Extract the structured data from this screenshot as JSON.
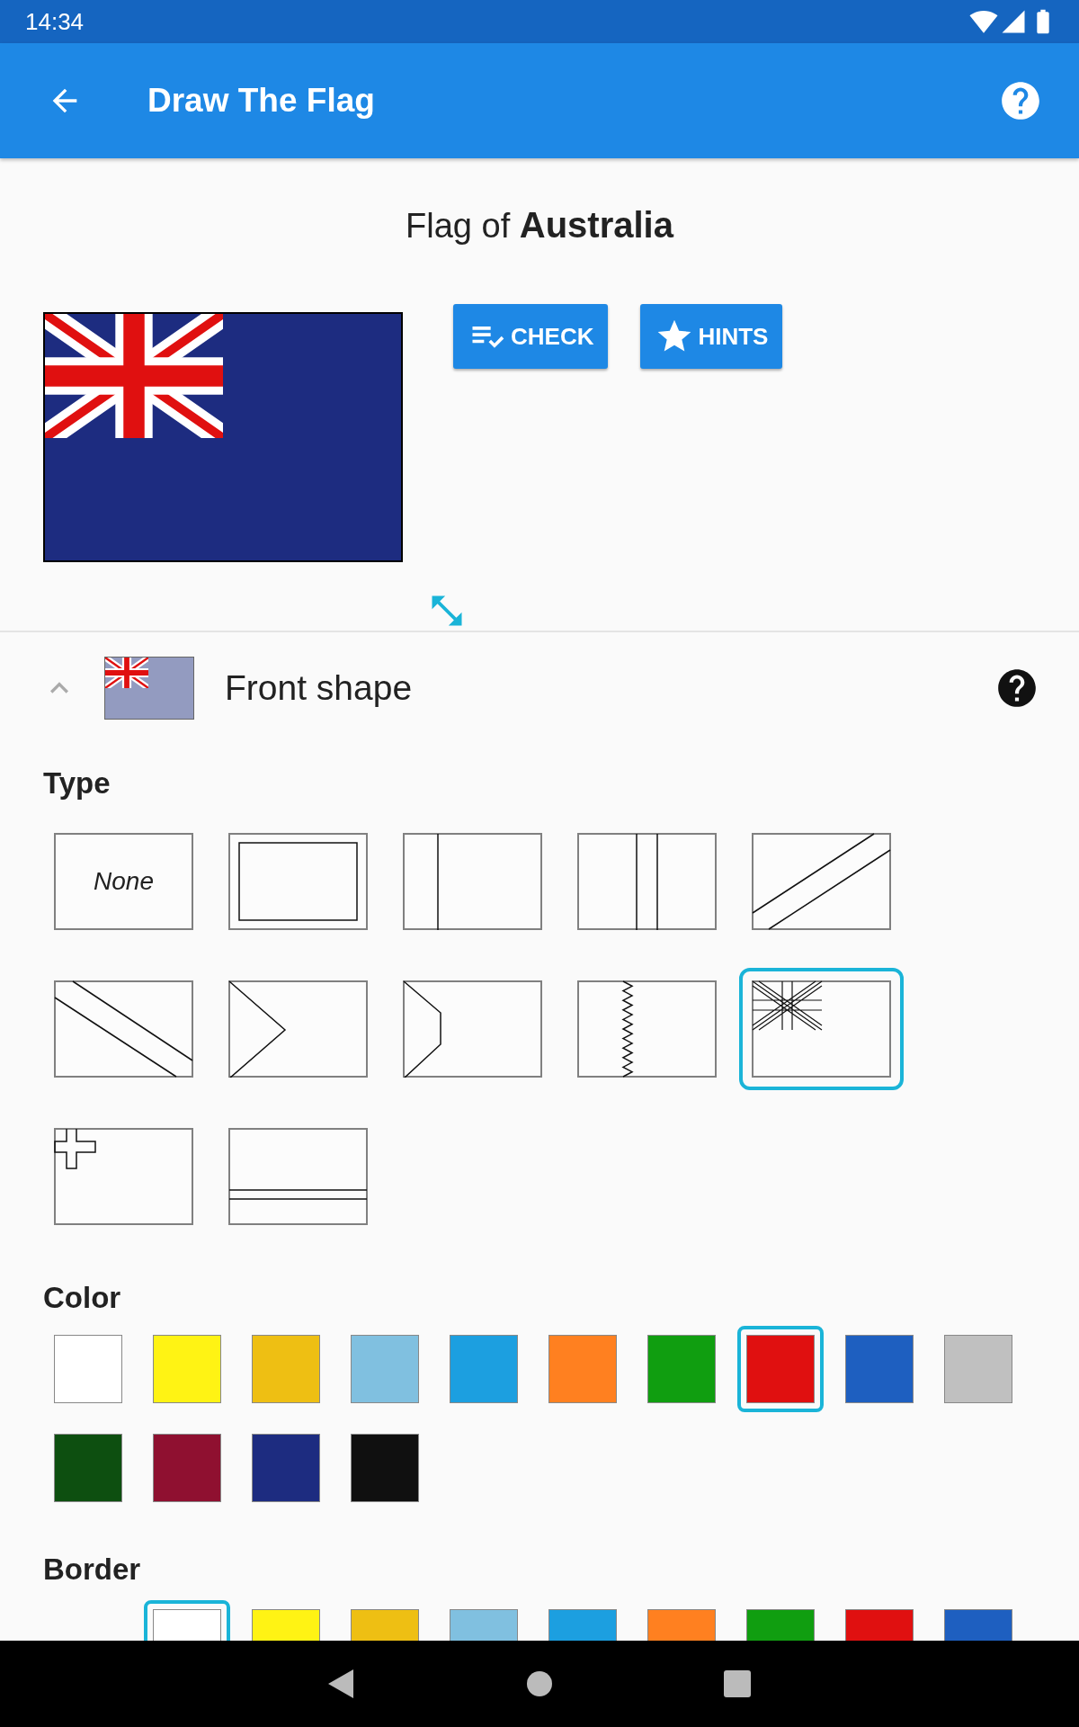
{
  "status_bar": {
    "time": "14:34"
  },
  "app_bar": {
    "title": "Draw The Flag"
  },
  "heading": "Flag of **Australia**",
  "buttons": [
    {
      "label": "CHECK",
      "kind": "check"
    },
    {
      "label": "HINTS",
      "kind": "hints"
    }
  ],
  "section": {
    "title": "Front shape",
    "expanded": true
  },
  "type": {
    "label": "Type",
    "options": [
      {
        "kind": "none",
        "label": "None",
        "selected": false
      },
      {
        "kind": "border",
        "selected": false
      },
      {
        "kind": "hoist-stripe",
        "selected": false
      },
      {
        "kind": "center-stripe",
        "selected": false
      },
      {
        "kind": "diagonal-up",
        "selected": false
      },
      {
        "kind": "diagonal-down",
        "selected": false
      },
      {
        "kind": "triangle",
        "selected": false
      },
      {
        "kind": "chevron",
        "selected": false
      },
      {
        "kind": "serrated",
        "selected": false
      },
      {
        "kind": "canton-union",
        "selected": true
      },
      {
        "kind": "canton-cross",
        "selected": false
      },
      {
        "kind": "horizontal-band",
        "selected": false
      }
    ]
  },
  "color": {
    "label": "Color",
    "options": [
      {
        "color": "#ffffff",
        "selected": false
      },
      {
        "color": "#fff314",
        "selected": false
      },
      {
        "color": "#eebf13",
        "selected": false
      },
      {
        "color": "#80c0e0",
        "selected": false
      },
      {
        "color": "#1c9fe0",
        "selected": false
      },
      {
        "color": "#ff8020",
        "selected": false
      },
      {
        "color": "#109e10",
        "selected": false
      },
      {
        "color": "#e01010",
        "selected": true
      },
      {
        "color": "#1e5fc0",
        "selected": false
      },
      {
        "color": "#c0c0c0",
        "selected": false
      },
      {
        "color": "#0d4f10",
        "selected": false
      },
      {
        "color": "#8f1030",
        "selected": false
      },
      {
        "color": "#1d2c80",
        "selected": false
      },
      {
        "color": "#101010",
        "selected": false
      }
    ]
  },
  "border": {
    "label": "Border",
    "options": [
      {
        "color": "#ffffff",
        "selected": true
      },
      {
        "color": "#fff314",
        "selected": false
      },
      {
        "color": "#eebf13",
        "selected": false
      },
      {
        "color": "#80c0e0",
        "selected": false
      },
      {
        "color": "#1c9fe0",
        "selected": false
      },
      {
        "color": "#ff8020",
        "selected": false
      },
      {
        "color": "#109e10",
        "selected": false
      },
      {
        "color": "#e01010",
        "selected": false
      },
      {
        "color": "#1e5fc0",
        "selected": false
      }
    ]
  }
}
